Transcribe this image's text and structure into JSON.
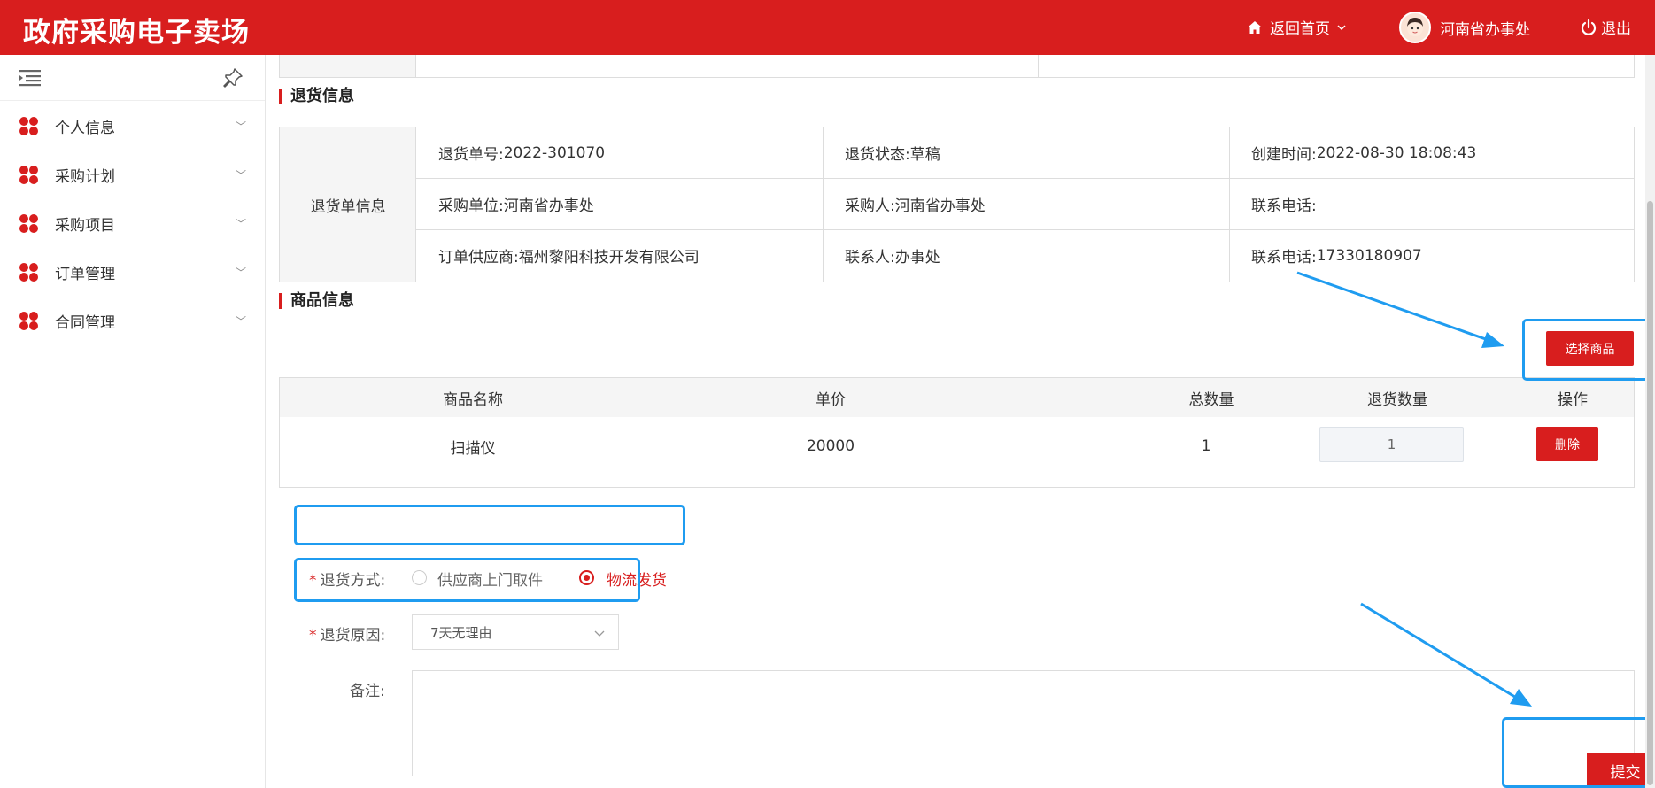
{
  "header": {
    "app_title": "政府采购电子卖场",
    "home_label": "返回首页",
    "user_name": "河南省办事处",
    "logout_label": "退出"
  },
  "sidebar": {
    "items": [
      {
        "label": "个人信息"
      },
      {
        "label": "采购计划"
      },
      {
        "label": "采购项目"
      },
      {
        "label": "订单管理"
      },
      {
        "label": "合同管理"
      }
    ]
  },
  "return_info": {
    "section_title": "退货信息",
    "row_header": "退货单信息",
    "fields": [
      {
        "label": "退货单号:",
        "value": "2022-301070"
      },
      {
        "label": "退货状态:",
        "value": "草稿"
      },
      {
        "label": "创建时间:",
        "value": "2022-08-30 18:08:43"
      },
      {
        "label": "采购单位:",
        "value": "河南省办事处"
      },
      {
        "label": "采购人:",
        "value": "河南省办事处"
      },
      {
        "label": "联系电话:",
        "value": ""
      },
      {
        "label": "订单供应商:",
        "value": "福州黎阳科技开发有限公司"
      },
      {
        "label": "联系人:",
        "value": "办事处"
      },
      {
        "label": "联系电话:",
        "value": "17330180907"
      }
    ]
  },
  "goods_info": {
    "section_title": "商品信息",
    "select_button": "选择商品",
    "columns": [
      "商品名称",
      "单价",
      "总数量",
      "退货数量",
      "操作"
    ],
    "rows": [
      {
        "name": "扫描仪",
        "price": "20000",
        "total": "1",
        "return_qty": "1",
        "action": "删除"
      }
    ]
  },
  "form": {
    "method_label": "退货方式:",
    "method_options": [
      {
        "label": "供应商上门取件",
        "selected": false
      },
      {
        "label": "物流发货",
        "selected": true
      }
    ],
    "reason_label": "退货原因:",
    "reason_value": "7天无理由",
    "remark_label": "备注:",
    "remark_value": "",
    "submit_label": "提交"
  },
  "colors": {
    "accent": "#d81e1e",
    "highlight": "#1f9cf0"
  }
}
